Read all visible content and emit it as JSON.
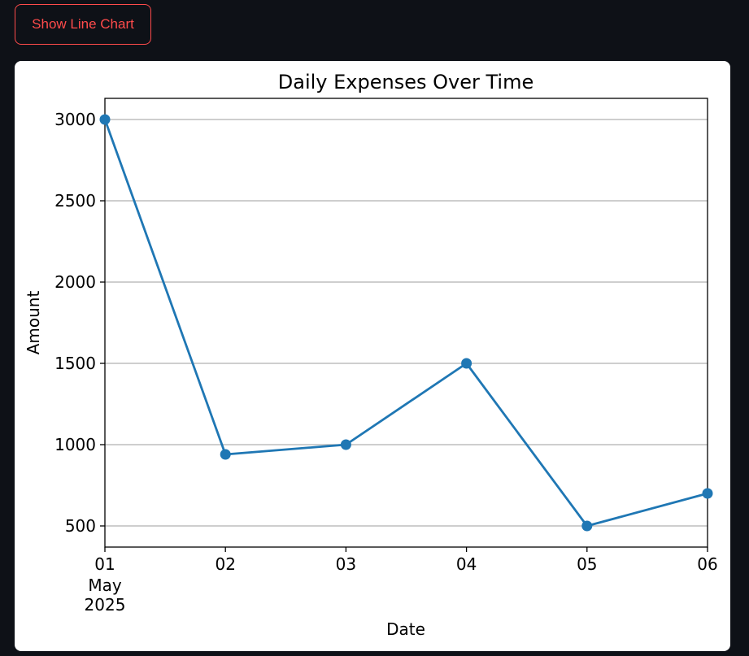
{
  "toolbar": {
    "toggle_label": "Show Line Chart"
  },
  "colors": {
    "page_background": "#0e1117",
    "accent": "#ff4b4b",
    "series": "#1f77b4",
    "grid": "#b0b0b0"
  },
  "chart_data": {
    "type": "line",
    "title": "Daily Expenses Over Time",
    "xlabel": "Date",
    "ylabel": "Amount",
    "x": [
      "2025-05-01",
      "2025-05-02",
      "2025-05-03",
      "2025-05-04",
      "2025-05-05",
      "2025-05-06"
    ],
    "x_tick_labels": [
      "01",
      "02",
      "03",
      "04",
      "05",
      "06"
    ],
    "x_tick_sublabels": [
      "May",
      "2025"
    ],
    "series": [
      {
        "values": [
          3000,
          940,
          1000,
          1500,
          500,
          700
        ],
        "marker": "circle"
      }
    ],
    "yticks": [
      500,
      1000,
      1500,
      2000,
      2500,
      3000
    ],
    "ylim": [
      370,
      3130
    ],
    "xlim": [
      "2025-05-01",
      "2025-05-06"
    ],
    "grid": "y-axis only"
  }
}
